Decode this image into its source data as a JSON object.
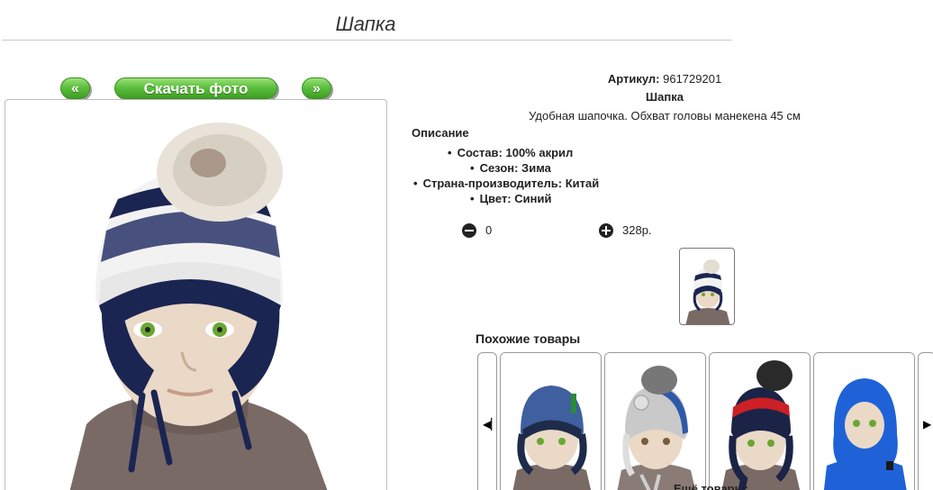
{
  "page": {
    "title": "Шапка"
  },
  "nav": {
    "prev_label": "«",
    "download_label": "Скачать фото",
    "next_label": "»"
  },
  "product": {
    "article_label": "Артикул:",
    "article_value": "961729201",
    "name": "Шапка",
    "short_description": "Удобная шапочка. Обхват головы манекена 45 см",
    "description_heading": "Описание",
    "specs": [
      "Состав: 100% акрил",
      "Сезон: Зима",
      "Страна-производитель: Китай",
      "Цвет: Синий"
    ],
    "quantity": "0",
    "price": "328р."
  },
  "similar": {
    "title": "Похожие товары",
    "prev_icon": "skip-back-icon",
    "next_icon": "skip-forward-icon",
    "more_label": "Ещё товары:",
    "items": [
      {
        "name": "hat-blue-green-earflaps",
        "hat_color": "#3f5f9e",
        "stripe_color": "#1e2b4a"
      },
      {
        "name": "hat-grey-blue-pompom",
        "hat_color": "#c9c9c9",
        "stripe_color": "#2d5aa8"
      },
      {
        "name": "hat-navy-red-pompom",
        "hat_color": "#1b2346",
        "stripe_color": "#cc2026"
      },
      {
        "name": "balaclava-blue",
        "hat_color": "#1f62d8",
        "stripe_color": "#1f62d8"
      }
    ]
  },
  "colors": {
    "button_green": "#5cbf3d",
    "hat_navy": "#1b2552",
    "hat_white": "#f2f2f2",
    "sweater_brown": "#7a6a66",
    "skin": "#ead9c7"
  }
}
